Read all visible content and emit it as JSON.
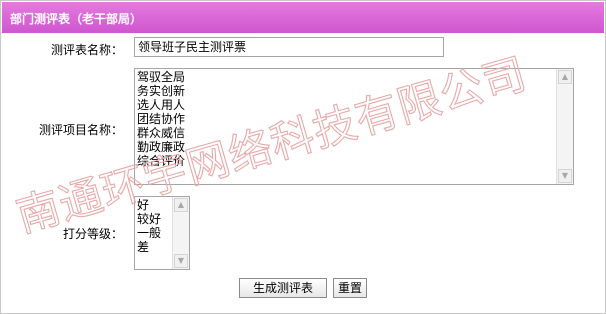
{
  "panel": {
    "title": "部门测评表（老干部局）"
  },
  "form": {
    "name_label": "测评表名称：",
    "name_value": "领导班子民主测评票",
    "items_label": "测评项目名称：",
    "items": [
      "驾驭全局",
      "务实创新",
      "选人用人",
      "团结协作",
      "群众威信",
      "勤政廉政",
      "综合评价"
    ],
    "grade_label": "打分等级：",
    "grades": [
      "好",
      "较好",
      "一般",
      "差"
    ]
  },
  "buttons": {
    "generate": "生成测评表",
    "reset": "重置"
  },
  "watermark": "南通环宇网络科技有限公司",
  "colors": {
    "title_bar": "#d65ed6",
    "watermark": "#e8a8a8"
  }
}
